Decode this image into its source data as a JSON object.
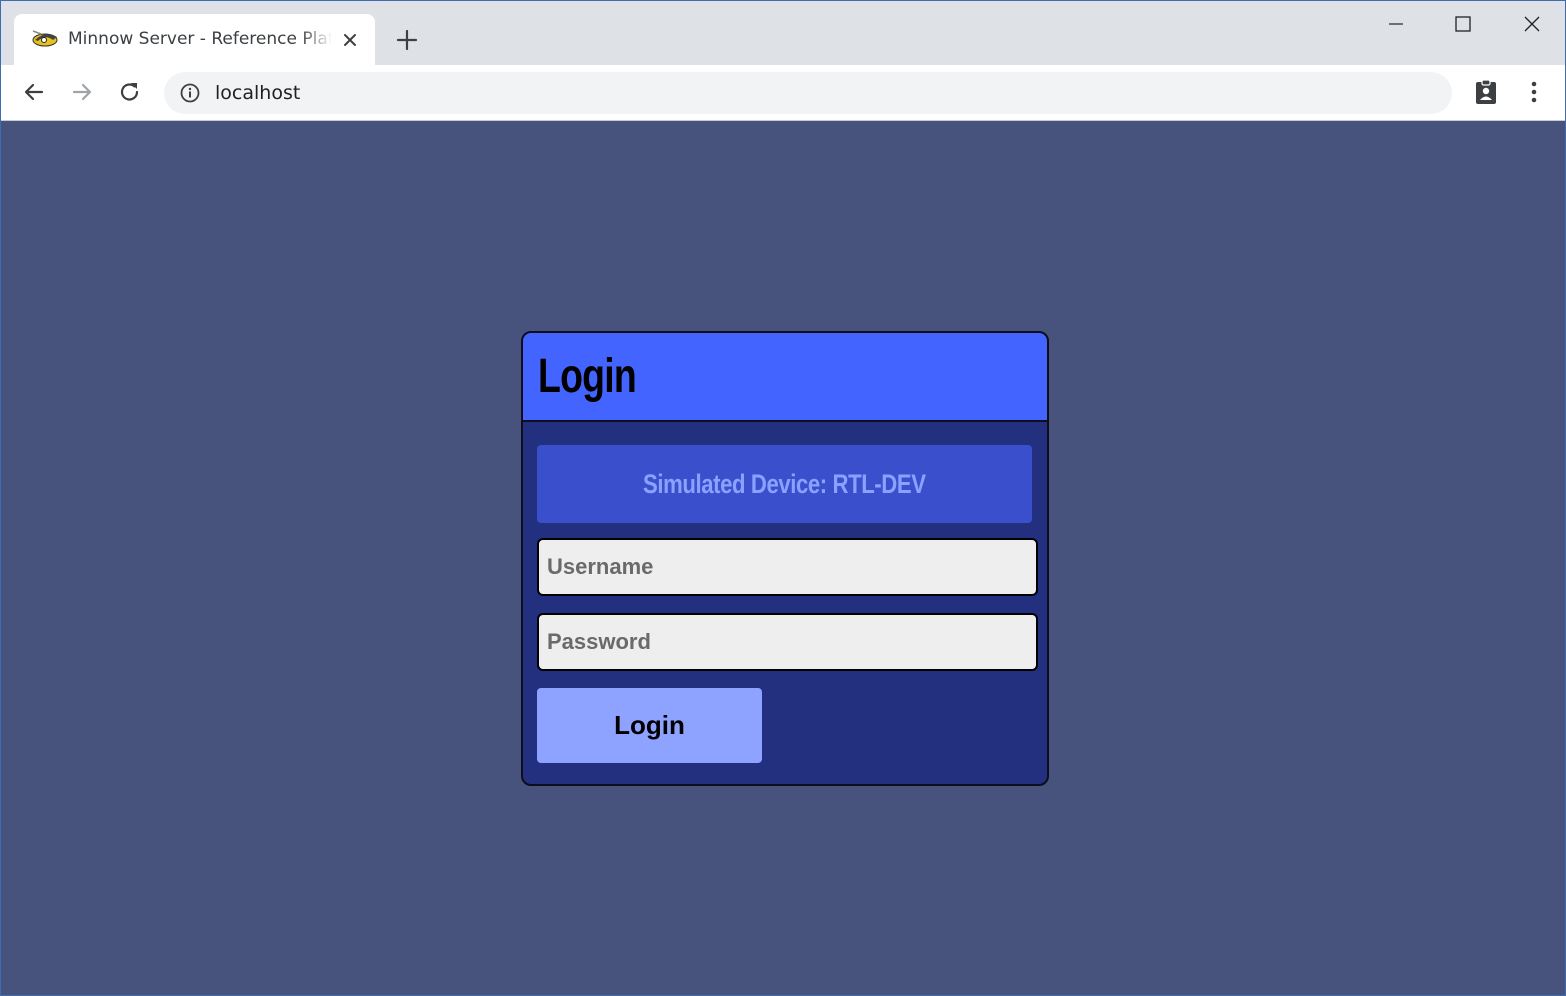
{
  "browser": {
    "tab_title": "Minnow Server - Reference Platform",
    "url": "localhost"
  },
  "login": {
    "heading": "Login",
    "device_label": "Simulated Device: RTL-DEV",
    "username_placeholder": "Username",
    "password_placeholder": "Password",
    "submit_label": "Login"
  },
  "colors": {
    "page_background": "#47537d",
    "card_header": "#4364ff",
    "card_body": "#233080",
    "device_banner": "#3a4fcc",
    "device_text": "#8aa1ff",
    "button": "#8ea2ff"
  }
}
